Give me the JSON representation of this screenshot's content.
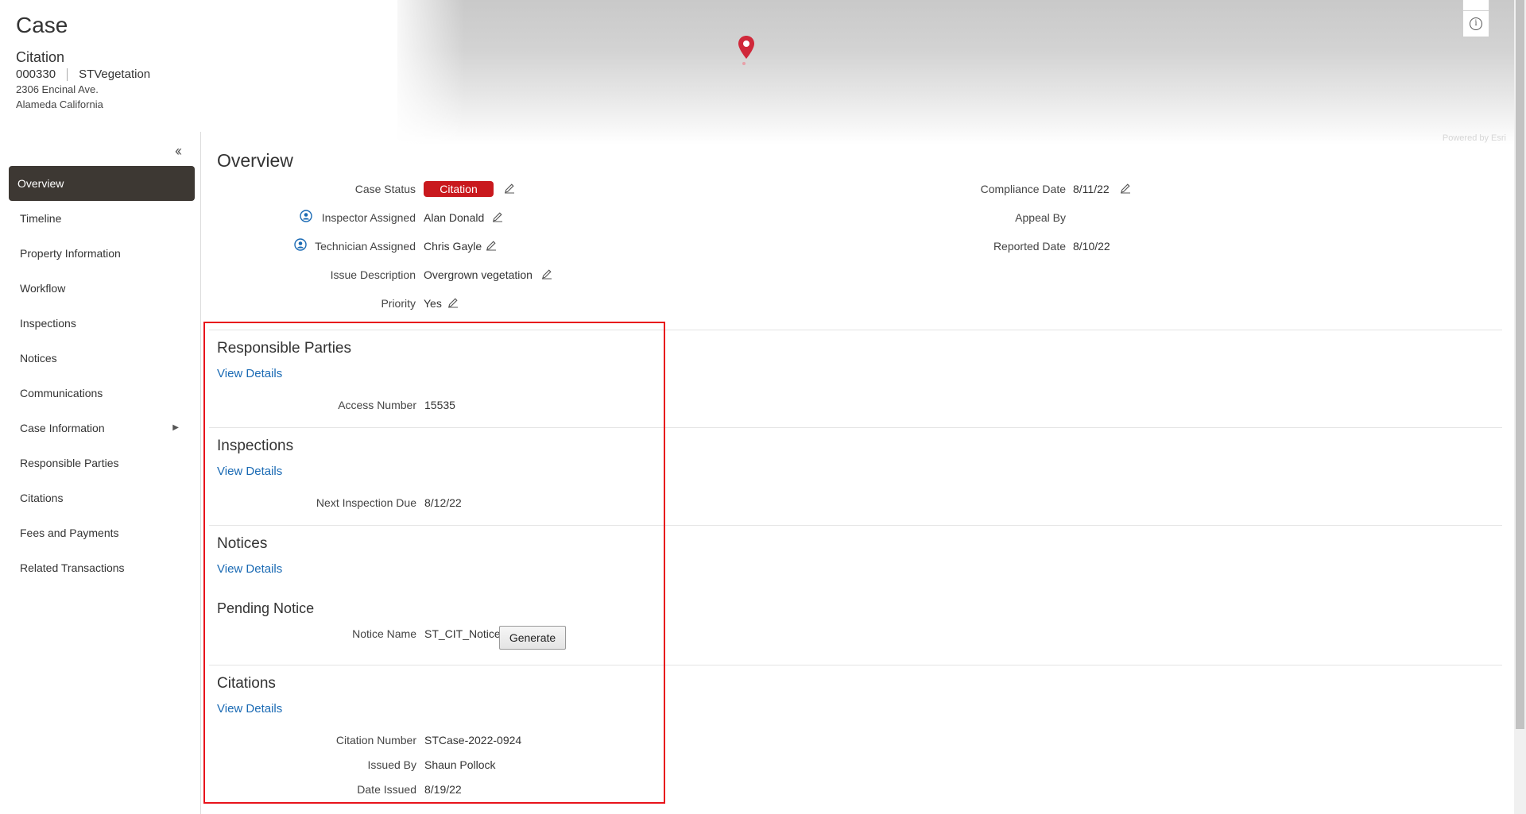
{
  "header": {
    "title": "Case",
    "case_type": "Citation",
    "case_number": "000330",
    "case_category": "STVegetation",
    "address_line1": "2306 Encinal Ave.",
    "address_line2": "Alameda California"
  },
  "map": {
    "attribution": "Powered by Esri",
    "pin_color": "#d0283a"
  },
  "sidebar": {
    "collapse_icon": "double-chevron-left-icon",
    "items": [
      {
        "label": "Overview",
        "active": true
      },
      {
        "label": "Timeline"
      },
      {
        "label": "Property Information"
      },
      {
        "label": "Workflow"
      },
      {
        "label": "Inspections"
      },
      {
        "label": "Notices"
      },
      {
        "label": "Communications"
      },
      {
        "label": "Case Information",
        "has_submenu": true
      },
      {
        "label": "Responsible Parties"
      },
      {
        "label": "Citations"
      },
      {
        "label": "Fees and Payments"
      },
      {
        "label": "Related Transactions"
      }
    ]
  },
  "overview": {
    "title": "Overview",
    "case_status_label": "Case Status",
    "case_status_value": "Citation",
    "status_color": "#c9191e",
    "inspector_label": "Inspector Assigned",
    "inspector_value": "Alan Donald",
    "technician_label": "Technician Assigned",
    "technician_value": "Chris Gayle",
    "issue_label": "Issue Description",
    "issue_value": "Overgrown vegetation",
    "priority_label": "Priority",
    "priority_value": "Yes",
    "compliance_label": "Compliance Date",
    "compliance_value": "8/11/22",
    "appeal_label": "Appeal By",
    "appeal_value": "",
    "reported_label": "Reported Date",
    "reported_value": "8/10/22"
  },
  "responsible_parties": {
    "title": "Responsible Parties",
    "link": "View Details",
    "access_label": "Access Number",
    "access_value": "15535"
  },
  "inspections": {
    "title": "Inspections",
    "link": "View Details",
    "next_label": "Next Inspection Due",
    "next_value": "8/12/22"
  },
  "notices": {
    "title": "Notices",
    "link": "View Details",
    "pending_title": "Pending Notice",
    "notice_name_label": "Notice Name",
    "notice_name_value": "ST_CIT_Notice",
    "generate_label": "Generate"
  },
  "citations": {
    "title": "Citations",
    "link": "View Details",
    "number_label": "Citation Number",
    "number_value": "STCase-2022-0924",
    "issued_by_label": "Issued By",
    "issued_by_value": "Shaun Pollock",
    "date_label": "Date Issued",
    "date_value": "8/19/22"
  }
}
